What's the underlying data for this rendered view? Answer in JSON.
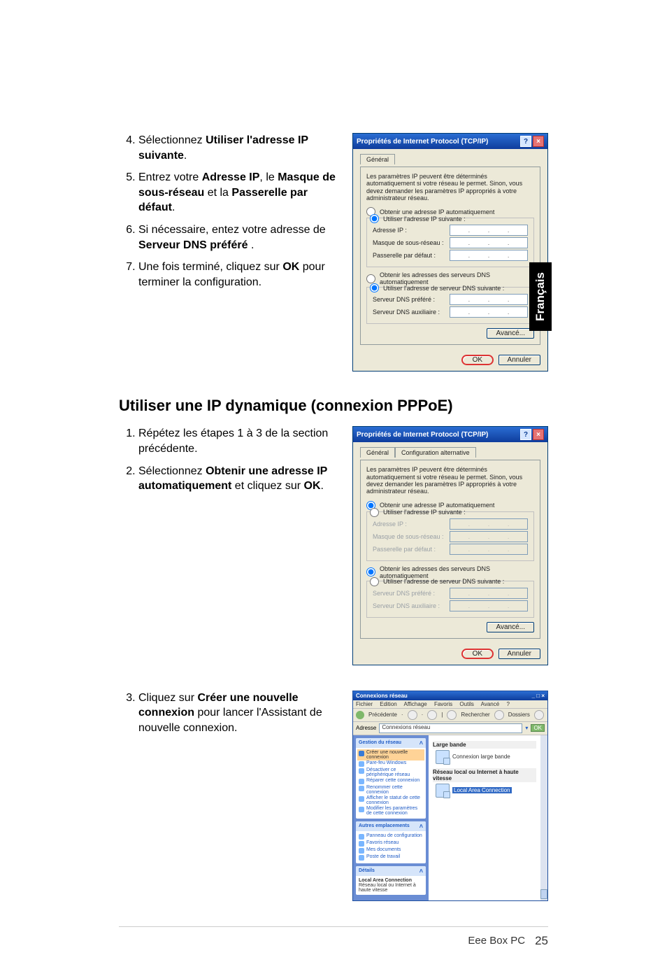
{
  "side_tab": "Français",
  "steps_a": {
    "s4_pre": "Sélectionnez ",
    "s4_b1": "Utiliser l'adresse IP suivante",
    "s4_post": ".",
    "s5_pre": "Entrez votre ",
    "s5_b1": "Adresse IP",
    "s5_mid1": ", le ",
    "s5_b2": "Masque de sous-réseau",
    "s5_mid2": " et la ",
    "s5_b3": "Passerelle par défaut",
    "s5_post": ".",
    "s6_pre": "Si nécessaire, entez votre adresse de ",
    "s6_b1": "Serveur DNS préféré",
    "s6_post": " .",
    "s7_pre": "Une fois terminé, cliquez sur ",
    "s7_b1": "OK",
    "s7_post": " pour terminer la configuration."
  },
  "section2_title": "Utiliser une IP dynamique (connexion PPPoE)",
  "steps_b": {
    "s1": "Répétez les étapes 1 à 3 de la section précédente.",
    "s2_pre": "Sélectionnez ",
    "s2_b1": "Obtenir une adresse IP automatiquement",
    "s2_mid": " et cliquez sur ",
    "s2_b2": "OK",
    "s2_post": "."
  },
  "steps_c": {
    "s3_pre": "Cliquez sur ",
    "s3_b1": "Créer une nouvelle connexion",
    "s3_post": " pour lancer l'Assistant de nouvelle connexion."
  },
  "dlg1": {
    "title": "Propriétés de Internet Protocol (TCP/IP)",
    "tab_general": "Général",
    "desc": "Les paramètres IP peuvent être déterminés automatiquement si votre réseau le permet. Sinon, vous devez demander les paramètres IP appropriés à votre administrateur réseau.",
    "r_auto_ip": "Obtenir une adresse IP automatiquement",
    "r_use_ip": "Utiliser l'adresse IP suivante :",
    "l_ip": "Adresse IP :",
    "l_mask": "Masque de sous-réseau :",
    "l_gw": "Passerelle par défaut :",
    "r_auto_dns": "Obtenir les adresses des serveurs DNS automatiquement",
    "r_use_dns": "Utiliser l'adresse de serveur DNS suivante :",
    "l_dns1": "Serveur DNS préféré :",
    "l_dns2": "Serveur DNS auxiliaire :",
    "btn_adv": "Avancé...",
    "btn_ok": "OK",
    "btn_cancel": "Annuler"
  },
  "dlg2": {
    "title": "Propriétés de Internet Protocol (TCP/IP)",
    "tab_general": "Général",
    "tab_alt": "Configuration alternative",
    "desc": "Les paramètres IP peuvent être déterminés automatiquement si votre réseau le permet. Sinon, vous devez demander les paramètres IP appropriés à votre administrateur réseau.",
    "r_auto_ip": "Obtenir une adresse IP automatiquement",
    "r_use_ip": "Utiliser l'adresse IP suivante :",
    "l_ip": "Adresse IP :",
    "l_mask": "Masque de sous-réseau :",
    "l_gw": "Passerelle par défaut :",
    "r_auto_dns": "Obtenir les adresses des serveurs DNS automatiquement",
    "r_use_dns": "Utiliser l'adresse de serveur DNS suivante :",
    "l_dns1": "Serveur DNS préféré :",
    "l_dns2": "Serveur DNS auxiliaire :",
    "btn_adv": "Avancé...",
    "btn_ok": "OK",
    "btn_cancel": "Annuler"
  },
  "conn": {
    "title": "Connexions réseau",
    "menu": {
      "m1": "Fichier",
      "m2": "Edition",
      "m3": "Affichage",
      "m4": "Favoris",
      "m5": "Outils",
      "m6": "Avancé",
      "m7": "?"
    },
    "toolbar": {
      "back": "Précédente",
      "search": "Rechercher",
      "folders": "Dossiers"
    },
    "addressbar_label": "Adresse",
    "addressbar_value": "Connexions réseau",
    "go": "OK",
    "tasks": {
      "head1": "Gestion du réseau",
      "i1": "Créer une nouvelle connexion",
      "i2": "Pare-feu Windows",
      "i3": "Désactiver ce périphérique réseau",
      "i4": "Réparer cette connexion",
      "i5": "Renommer cette connexion",
      "i6": "Afficher le statut de cette connexion",
      "i7": "Modifier les paramètres de cette connexion",
      "head2": "Autres emplacements",
      "j1": "Panneau de configuration",
      "j2": "Favoris réseau",
      "j3": "Mes documents",
      "j4": "Poste de travail",
      "head3": "Détails",
      "d1": "Local Area Connection",
      "d2": "Réseau local ou Internet à haute vitesse"
    },
    "main": {
      "cat1": "Large bande",
      "item1": "Connexion large bande",
      "cat2": "Réseau local ou Internet à haute vitesse",
      "item2": "Local Area Connection"
    }
  },
  "footer": {
    "product": "Eee Box PC",
    "page": "25"
  }
}
